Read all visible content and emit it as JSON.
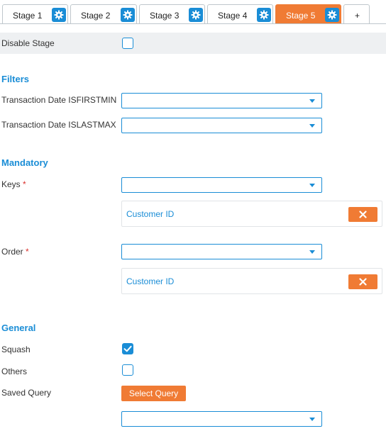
{
  "tabs": [
    {
      "label": "Stage 1",
      "icon": "gear-icon"
    },
    {
      "label": "Stage 2",
      "icon": "gear-icon"
    },
    {
      "label": "Stage 3",
      "icon": "gear-icon"
    },
    {
      "label": "Stage 4",
      "icon": "gear-icon"
    },
    {
      "label": "Stage 5",
      "icon": "gear-icon",
      "active": true
    }
  ],
  "add_tab_label": "+",
  "disable_stage": {
    "label": "Disable Stage",
    "checked": false
  },
  "filters": {
    "title": "Filters",
    "fields": [
      {
        "label": "Transaction Date ISFIRSTMIN",
        "value": ""
      },
      {
        "label": "Transaction Date ISLASTMAX",
        "value": ""
      }
    ]
  },
  "mandatory": {
    "title": "Mandatory",
    "keys": {
      "label": "Keys",
      "required_mark": "*",
      "value": "",
      "selected": [
        "Customer ID"
      ]
    },
    "order": {
      "label": "Order",
      "required_mark": "*",
      "value": "",
      "selected": [
        "Customer ID"
      ]
    }
  },
  "general": {
    "title": "General",
    "squash": {
      "label": "Squash",
      "checked": true
    },
    "others": {
      "label": "Others",
      "checked": false
    },
    "saved_query": {
      "label": "Saved Query",
      "button_label": "Select Query",
      "value": ""
    }
  },
  "colors": {
    "accent": "#1a8dd6",
    "active_tab": "#f07b34",
    "remove_button": "#f07b34",
    "required": "#d9302c"
  }
}
